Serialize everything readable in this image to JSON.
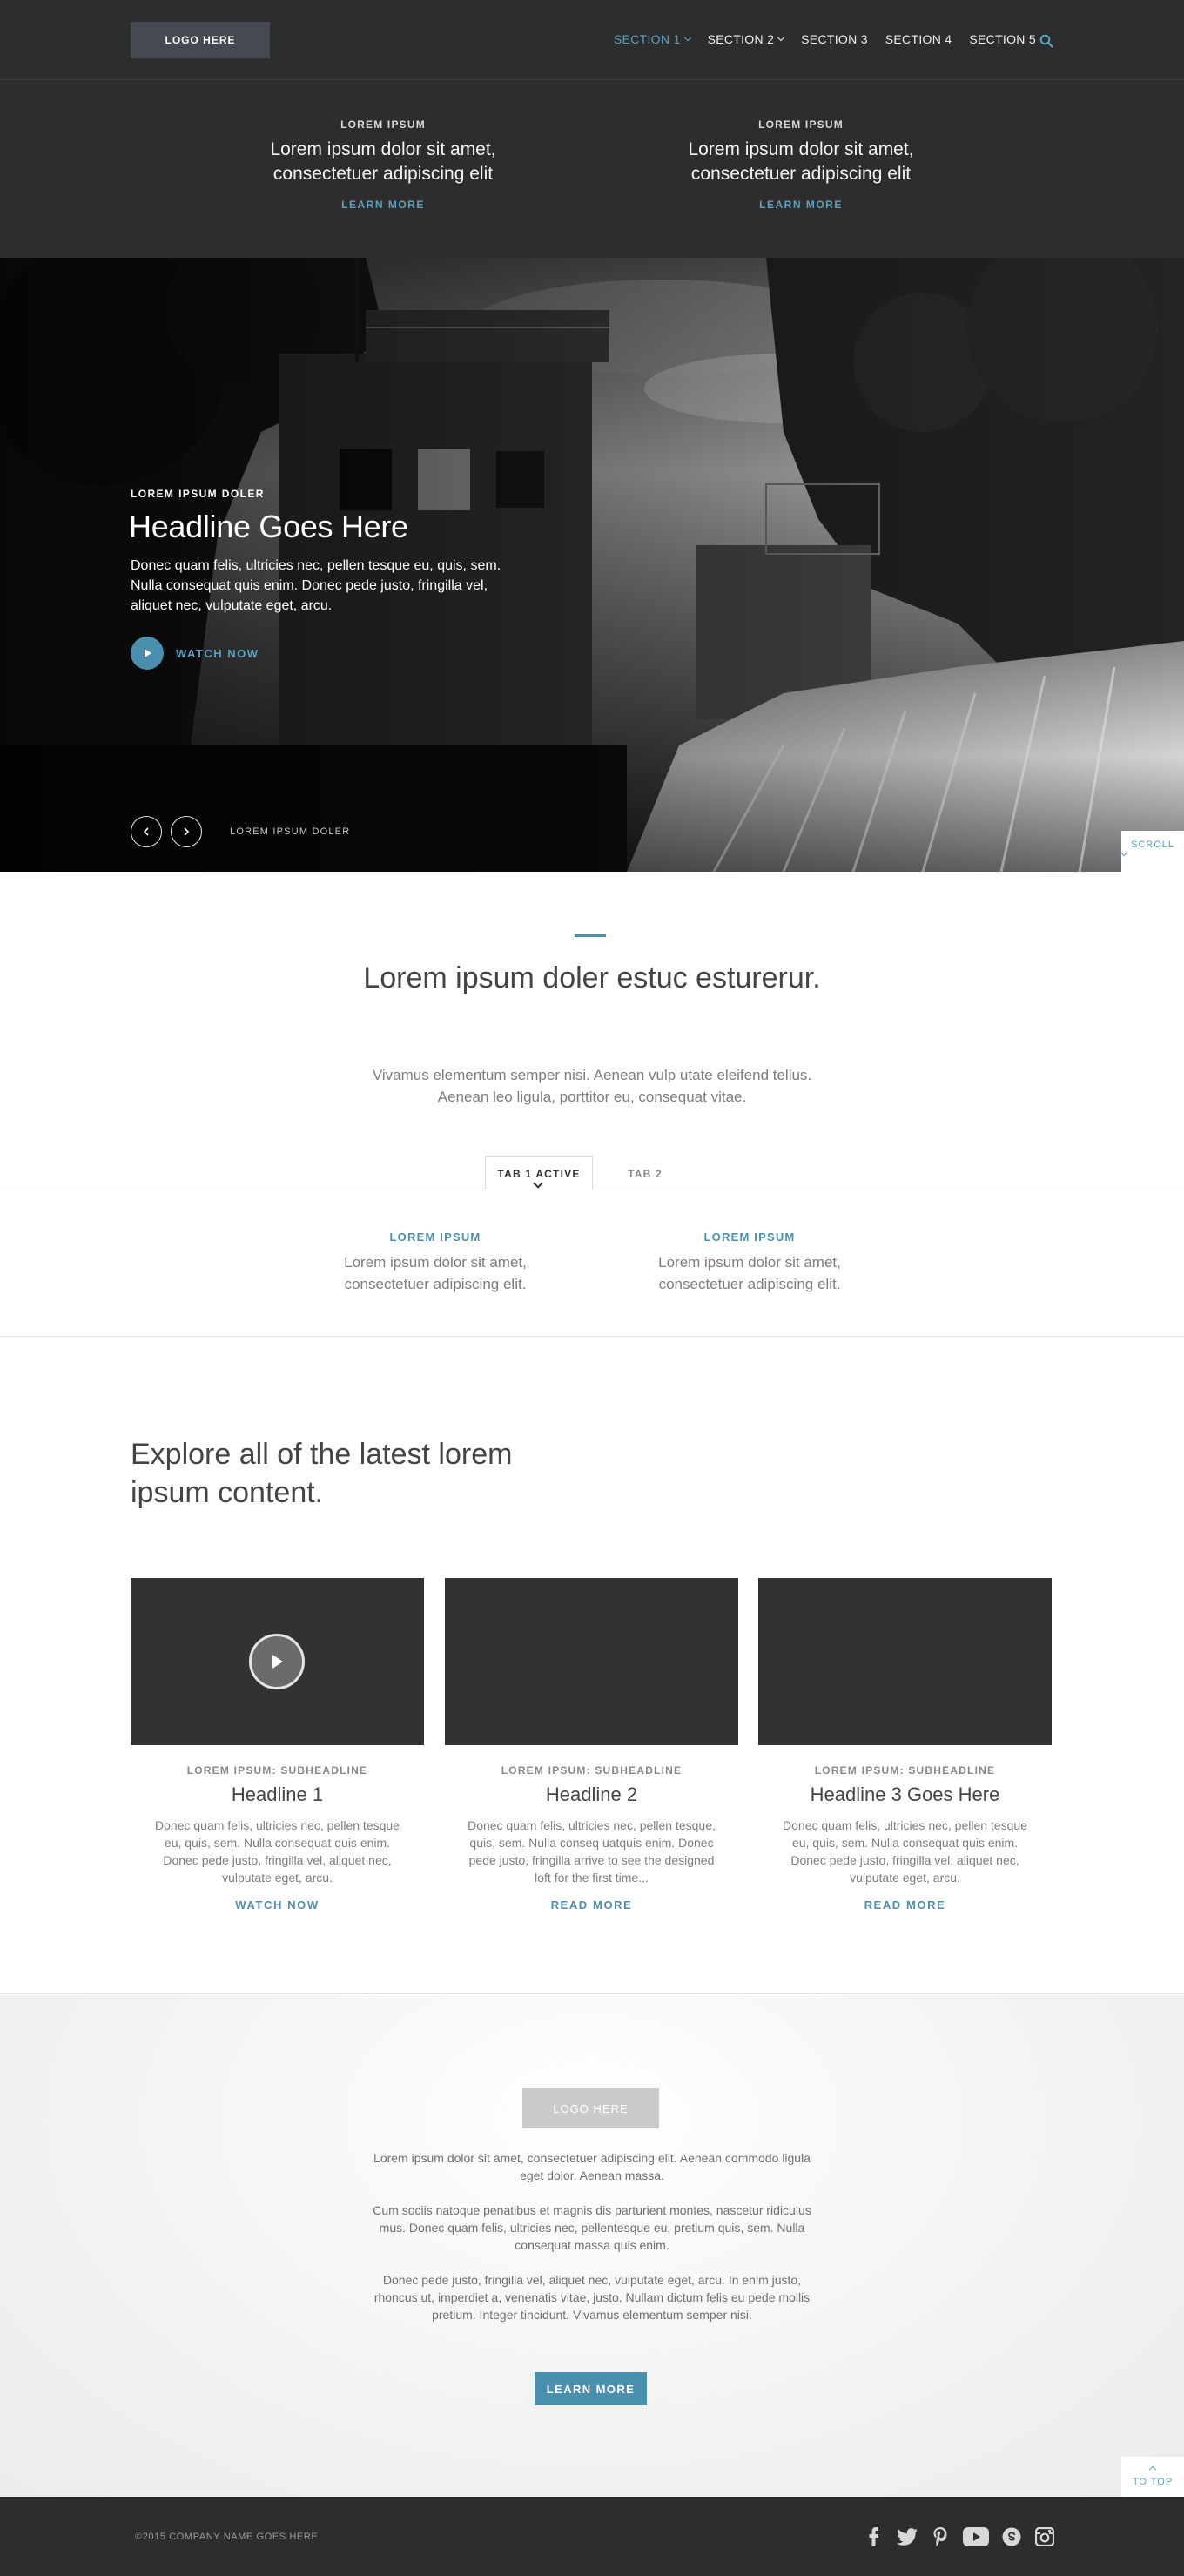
{
  "header": {
    "logo": "LOGO HERE",
    "nav": [
      {
        "label": "SECTION 1",
        "active": true,
        "dropdown": true
      },
      {
        "label": "SECTION 2",
        "active": false,
        "dropdown": true
      },
      {
        "label": "SECTION 3",
        "active": false,
        "dropdown": false
      },
      {
        "label": "SECTION 4",
        "active": false,
        "dropdown": false
      },
      {
        "label": "SECTION 5",
        "active": false,
        "dropdown": false
      }
    ],
    "search_icon": "search-icon"
  },
  "dropdown": {
    "items": [
      {
        "kicker": "LOREM IPSUM",
        "text": "Lorem ipsum dolor sit amet, consectetuer adipiscing elit",
        "link": "LEARN MORE"
      },
      {
        "kicker": "LOREM IPSUM",
        "text": "Lorem ipsum dolor sit amet, consectetuer adipiscing elit",
        "link": "LEARN MORE"
      }
    ]
  },
  "hero": {
    "kicker": "LOREM IPSUM DOLER",
    "title": "Headline Goes Here",
    "body": "Donec quam felis, ultricies nec, pellen tesque eu, quis, sem. Nulla consequat quis enim. Donec pede justo, fringilla vel, aliquet nec, vulputate eget, arcu.",
    "cta": "WATCH NOW",
    "slide_label": "LOREM IPSUM DOLER",
    "scroll_label": "SCROLL"
  },
  "intro": {
    "title": "Lorem ipsum doler estuc esturerur.",
    "body": "Vivamus elementum semper nisi. Aenean vulp utate eleifend tellus. Aenean leo ligula, porttitor eu, consequat vitae.",
    "tabs": [
      {
        "label": "TAB 1 ACTIVE",
        "active": true
      },
      {
        "label": "TAB 2",
        "active": false
      }
    ]
  },
  "tab_content": {
    "items": [
      {
        "kicker": "LOREM IPSUM",
        "text": "Lorem ipsum dolor sit amet, consectetuer adipiscing elit."
      },
      {
        "kicker": "LOREM IPSUM",
        "text": "Lorem ipsum dolor sit amet, consectetuer adipiscing elit."
      }
    ]
  },
  "explore": {
    "title": "Explore all of the latest lorem ipsum content.",
    "cards": [
      {
        "kicker": "LOREM IPSUM: SUBHEADLINE",
        "title": "Headline 1",
        "body": "Donec quam felis, ultricies nec, pellen tesque eu, quis, sem. Nulla consequat quis enim. Donec pede justo, fringilla vel, aliquet nec, vulputate eget, arcu.",
        "link": "WATCH NOW",
        "has_play": true
      },
      {
        "kicker": "LOREM IPSUM: SUBHEADLINE",
        "title": "Headline 2",
        "body": "Donec quam felis, ultricies nec, pellen tesque, quis, sem. Nulla conseq uatquis enim. Donec pede justo, fringilla arrive to see the designed loft for the first time...",
        "link": "READ MORE",
        "has_play": false
      },
      {
        "kicker": "LOREM IPSUM: SUBHEADLINE",
        "title": "Headline 3 Goes Here",
        "body": "Donec quam felis, ultricies nec, pellen tesque eu, quis, sem. Nulla consequat quis enim. Donec pede justo, fringilla vel, aliquet nec, vulputate eget, arcu.",
        "link": "READ MORE",
        "has_play": false
      }
    ]
  },
  "promo": {
    "logo": "LOGO HERE",
    "paragraphs": [
      "Lorem ipsum dolor sit amet, consectetuer adipiscing elit. Aenean commodo ligula eget dolor. Aenean massa.",
      "Cum sociis natoque penatibus et magnis dis parturient montes, nascetur ridiculus mus. Donec quam felis, ultricies nec, pellentesque eu, pretium quis, sem. Nulla consequat massa quis enim.",
      "Donec pede justo, fringilla vel, aliquet nec, vulputate eget, arcu. In enim justo, rhoncus ut, imperdiet a, venenatis vitae, justo. Nullam dictum felis eu pede mollis pretium. Integer tincidunt. Vivamus elementum semper nisi."
    ],
    "cta": "LEARN MORE",
    "to_top": "TO TOP"
  },
  "footer": {
    "copyright": "©2015 COMPANY NAME GOES HERE",
    "social": [
      "facebook-icon",
      "twitter-icon",
      "pinterest-icon",
      "youtube-icon",
      "skype-icon",
      "instagram-icon"
    ]
  },
  "colors": {
    "accent": "#4a8fae",
    "dark": "#2d2d2d"
  }
}
